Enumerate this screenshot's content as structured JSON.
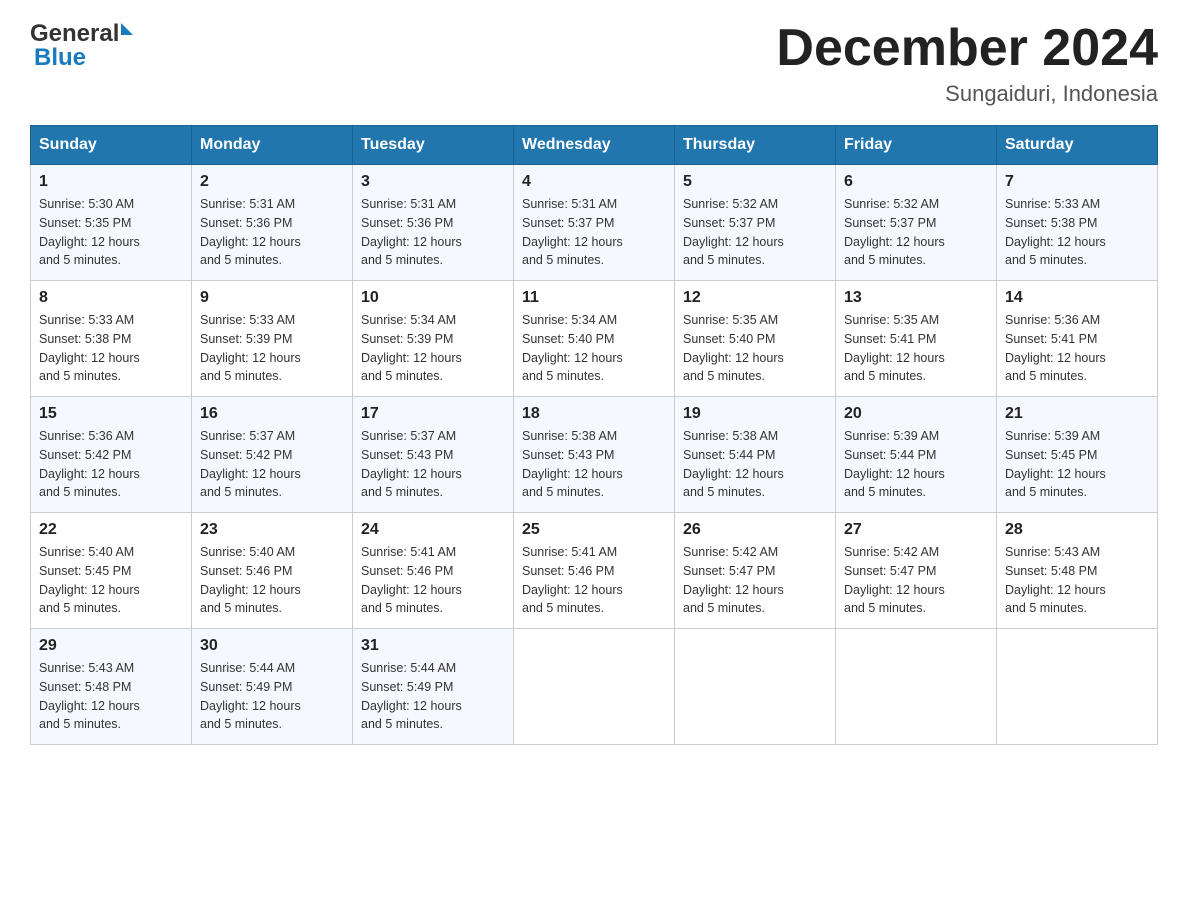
{
  "header": {
    "logo_general": "General",
    "logo_blue": "Blue",
    "title": "December 2024",
    "subtitle": "Sungaiduri, Indonesia"
  },
  "days_of_week": [
    "Sunday",
    "Monday",
    "Tuesday",
    "Wednesday",
    "Thursday",
    "Friday",
    "Saturday"
  ],
  "weeks": [
    [
      {
        "day": "1",
        "sunrise": "5:30 AM",
        "sunset": "5:35 PM",
        "daylight": "12 hours and 5 minutes."
      },
      {
        "day": "2",
        "sunrise": "5:31 AM",
        "sunset": "5:36 PM",
        "daylight": "12 hours and 5 minutes."
      },
      {
        "day": "3",
        "sunrise": "5:31 AM",
        "sunset": "5:36 PM",
        "daylight": "12 hours and 5 minutes."
      },
      {
        "day": "4",
        "sunrise": "5:31 AM",
        "sunset": "5:37 PM",
        "daylight": "12 hours and 5 minutes."
      },
      {
        "day": "5",
        "sunrise": "5:32 AM",
        "sunset": "5:37 PM",
        "daylight": "12 hours and 5 minutes."
      },
      {
        "day": "6",
        "sunrise": "5:32 AM",
        "sunset": "5:37 PM",
        "daylight": "12 hours and 5 minutes."
      },
      {
        "day": "7",
        "sunrise": "5:33 AM",
        "sunset": "5:38 PM",
        "daylight": "12 hours and 5 minutes."
      }
    ],
    [
      {
        "day": "8",
        "sunrise": "5:33 AM",
        "sunset": "5:38 PM",
        "daylight": "12 hours and 5 minutes."
      },
      {
        "day": "9",
        "sunrise": "5:33 AM",
        "sunset": "5:39 PM",
        "daylight": "12 hours and 5 minutes."
      },
      {
        "day": "10",
        "sunrise": "5:34 AM",
        "sunset": "5:39 PM",
        "daylight": "12 hours and 5 minutes."
      },
      {
        "day": "11",
        "sunrise": "5:34 AM",
        "sunset": "5:40 PM",
        "daylight": "12 hours and 5 minutes."
      },
      {
        "day": "12",
        "sunrise": "5:35 AM",
        "sunset": "5:40 PM",
        "daylight": "12 hours and 5 minutes."
      },
      {
        "day": "13",
        "sunrise": "5:35 AM",
        "sunset": "5:41 PM",
        "daylight": "12 hours and 5 minutes."
      },
      {
        "day": "14",
        "sunrise": "5:36 AM",
        "sunset": "5:41 PM",
        "daylight": "12 hours and 5 minutes."
      }
    ],
    [
      {
        "day": "15",
        "sunrise": "5:36 AM",
        "sunset": "5:42 PM",
        "daylight": "12 hours and 5 minutes."
      },
      {
        "day": "16",
        "sunrise": "5:37 AM",
        "sunset": "5:42 PM",
        "daylight": "12 hours and 5 minutes."
      },
      {
        "day": "17",
        "sunrise": "5:37 AM",
        "sunset": "5:43 PM",
        "daylight": "12 hours and 5 minutes."
      },
      {
        "day": "18",
        "sunrise": "5:38 AM",
        "sunset": "5:43 PM",
        "daylight": "12 hours and 5 minutes."
      },
      {
        "day": "19",
        "sunrise": "5:38 AM",
        "sunset": "5:44 PM",
        "daylight": "12 hours and 5 minutes."
      },
      {
        "day": "20",
        "sunrise": "5:39 AM",
        "sunset": "5:44 PM",
        "daylight": "12 hours and 5 minutes."
      },
      {
        "day": "21",
        "sunrise": "5:39 AM",
        "sunset": "5:45 PM",
        "daylight": "12 hours and 5 minutes."
      }
    ],
    [
      {
        "day": "22",
        "sunrise": "5:40 AM",
        "sunset": "5:45 PM",
        "daylight": "12 hours and 5 minutes."
      },
      {
        "day": "23",
        "sunrise": "5:40 AM",
        "sunset": "5:46 PM",
        "daylight": "12 hours and 5 minutes."
      },
      {
        "day": "24",
        "sunrise": "5:41 AM",
        "sunset": "5:46 PM",
        "daylight": "12 hours and 5 minutes."
      },
      {
        "day": "25",
        "sunrise": "5:41 AM",
        "sunset": "5:46 PM",
        "daylight": "12 hours and 5 minutes."
      },
      {
        "day": "26",
        "sunrise": "5:42 AM",
        "sunset": "5:47 PM",
        "daylight": "12 hours and 5 minutes."
      },
      {
        "day": "27",
        "sunrise": "5:42 AM",
        "sunset": "5:47 PM",
        "daylight": "12 hours and 5 minutes."
      },
      {
        "day": "28",
        "sunrise": "5:43 AM",
        "sunset": "5:48 PM",
        "daylight": "12 hours and 5 minutes."
      }
    ],
    [
      {
        "day": "29",
        "sunrise": "5:43 AM",
        "sunset": "5:48 PM",
        "daylight": "12 hours and 5 minutes."
      },
      {
        "day": "30",
        "sunrise": "5:44 AM",
        "sunset": "5:49 PM",
        "daylight": "12 hours and 5 minutes."
      },
      {
        "day": "31",
        "sunrise": "5:44 AM",
        "sunset": "5:49 PM",
        "daylight": "12 hours and 5 minutes."
      },
      null,
      null,
      null,
      null
    ]
  ],
  "labels": {
    "sunrise": "Sunrise:",
    "sunset": "Sunset:",
    "daylight": "Daylight:"
  }
}
